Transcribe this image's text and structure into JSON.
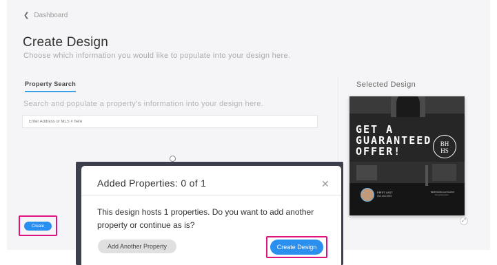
{
  "breadcrumb": {
    "label": "Dashboard",
    "icon": "chevron-left-icon"
  },
  "header": {
    "title": "Create Design",
    "subtitle": "Choose which information you would like to populate into your design here."
  },
  "tabs": [
    {
      "label": "Property Search",
      "active": true
    }
  ],
  "search": {
    "description": "Search and populate a property's information into your design here.",
    "placeholder": "Enter Address or MLS # here",
    "value": ""
  },
  "create_button": {
    "label": "Create"
  },
  "selected_design": {
    "title": "Selected Design",
    "headline_lines": [
      "GET A",
      "GUARANTEED",
      "OFFER!"
    ],
    "logo_text": [
      "BH",
      "HS"
    ],
    "agent_name": "FIRST LAST",
    "agent_phone": "555.555.5555",
    "brand_line": "BERKSHIRE HATHAWAY",
    "brand_line2": "HomeServices"
  },
  "modal": {
    "title": "Added Properties: 0 of 1",
    "body": "This design hosts 1 properties. Do you want to add another property or continue as is?",
    "add_another_label": "Add Another Property",
    "create_design_label": "Create Design"
  },
  "colors": {
    "accent": "#2b8ff0",
    "highlight": "#e0127f",
    "tab_underline": "#3aa0e8",
    "modal_backdrop": "#3d3f4c"
  }
}
